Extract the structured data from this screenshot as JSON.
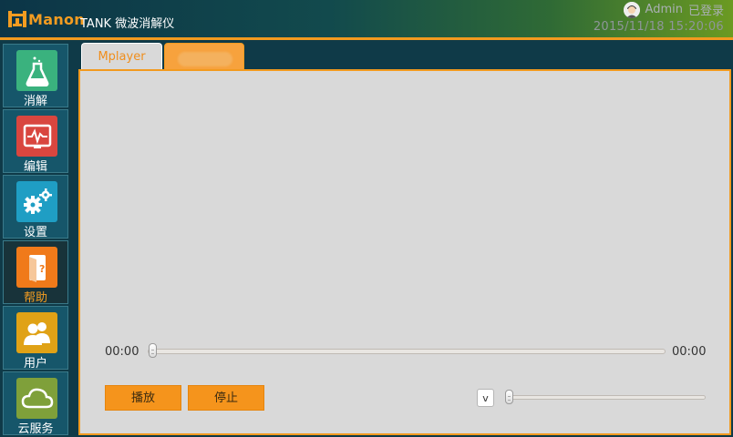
{
  "app": {
    "brand": "Manon",
    "title": "TANK 微波消解仪"
  },
  "user": {
    "name": "Admin",
    "status": "已登录",
    "datetime": "2015/11/18 15:20:06"
  },
  "sidebar": {
    "items": [
      {
        "label": "消解",
        "icon": "flask-icon",
        "color": "#3ab27e"
      },
      {
        "label": "编辑",
        "icon": "waveform-icon",
        "color": "#d9463f"
      },
      {
        "label": "设置",
        "icon": "gears-icon",
        "color": "#1f9ec4"
      },
      {
        "label": "帮助",
        "icon": "help-book-icon",
        "color": "#f07a1a"
      },
      {
        "label": "用户",
        "icon": "users-icon",
        "color": "#e0a216"
      },
      {
        "label": "云服务",
        "icon": "cloud-icon",
        "color": "#7fa03a"
      }
    ],
    "active_index": 3
  },
  "tabs": {
    "mplayer": "Mplayer",
    "second": ""
  },
  "player": {
    "current_time": "00:00",
    "total_time": "00:00",
    "progress": 0,
    "play_label": "播放",
    "stop_label": "停止",
    "volume_label": "v",
    "volume_level": 0
  },
  "colors": {
    "accent": "#f29a1f",
    "panel": "#d9d9d9"
  }
}
